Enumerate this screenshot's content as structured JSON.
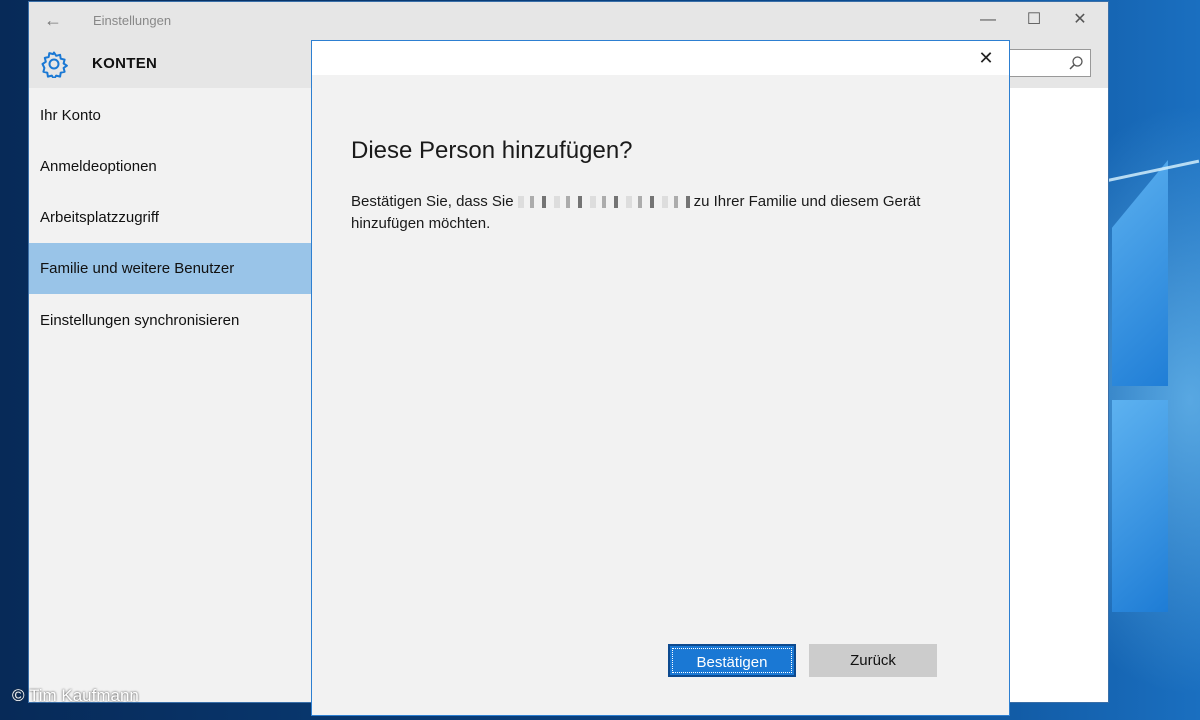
{
  "window": {
    "title": "Einstellungen",
    "minimize_glyph": "—",
    "maximize_glyph": "☐",
    "close_glyph": "✕",
    "back_glyph": "←"
  },
  "header": {
    "title": "KONTEN",
    "icon": "gear-icon",
    "search_icon": "search-icon"
  },
  "sidebar": {
    "items": [
      {
        "label": "Ihr Konto",
        "active": false
      },
      {
        "label": "Anmeldeoptionen",
        "active": false
      },
      {
        "label": "Arbeitsplatzzugriff",
        "active": false
      },
      {
        "label": "Familie und weitere Benutzer",
        "active": true
      },
      {
        "label": "Einstellungen synchronisieren",
        "active": false
      }
    ]
  },
  "dialog": {
    "close_glyph": "✕",
    "heading": "Diese Person hinzufügen?",
    "text_before": "Bestätigen Sie, dass Sie",
    "text_after": "zu Ihrer Familie und diesem Gerät hinzufügen möchten.",
    "confirm_label": "Bestätigen",
    "back_label": "Zurück"
  },
  "credit": "© Tim Kaufmann",
  "colors": {
    "accent": "#1a78d4",
    "active_nav": "#99c4e8",
    "dialog_border": "#2d7fd1"
  }
}
